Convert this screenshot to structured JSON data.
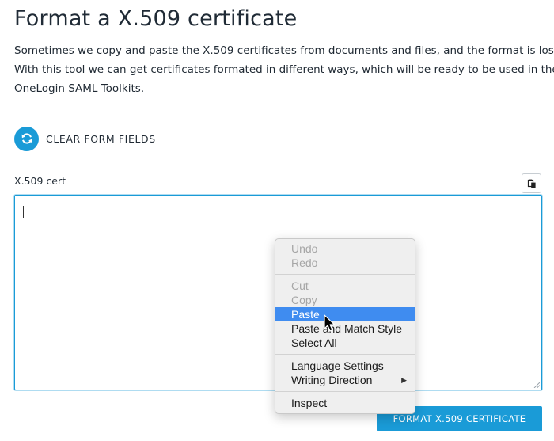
{
  "page": {
    "title": "Format a X.509 certificate",
    "intro_lines": [
      "Sometimes we copy and paste the X.509 certificates from documents and files, and the format is lost.",
      "With this tool we can get certificates formated in different ways, which will be ready to be used in the",
      "OneLogin SAML Toolkits."
    ]
  },
  "clear_button": {
    "label": "CLEAR FORM FIELDS",
    "icon": "refresh-icon"
  },
  "cert_field": {
    "label": "X.509 cert",
    "value": "",
    "paste_icon": "clipboard-icon"
  },
  "format_button": {
    "label": "FORMAT X.509 CERTIFICATE"
  },
  "context_menu": {
    "undo": "Undo",
    "redo": "Redo",
    "cut": "Cut",
    "copy": "Copy",
    "paste": "Paste",
    "paste_match": "Paste and Match Style",
    "select_all": "Select All",
    "language_settings": "Language Settings",
    "writing_direction": "Writing Direction",
    "inspect": "Inspect"
  },
  "colors": {
    "accent": "#1a9bd7",
    "menu_highlight": "#3f8cf0"
  }
}
